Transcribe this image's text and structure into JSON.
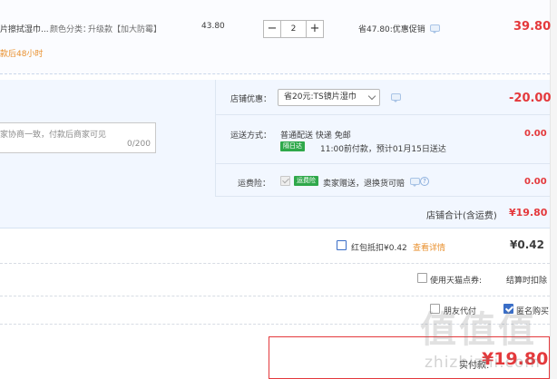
{
  "item": {
    "title_fragment": "片擦拭湿巾...",
    "spec_label": "颜色分类：",
    "spec_value": "升级款【加大防霉】",
    "unit_price": "43.80",
    "quantity": "2",
    "minus": "−",
    "plus": "+",
    "discount": "省47.80:优惠促销",
    "subtotal": "39.80",
    "ship_notice": "款后48小时"
  },
  "shop_promo": {
    "label": "店铺优惠：",
    "selected": "省20元:TS镜片湿巾",
    "amount": "-20.00"
  },
  "message": {
    "placeholder": "家协商一致，付款后商家可见",
    "counter": "0/200"
  },
  "shipping": {
    "label": "运送方式：",
    "method": "普通配送 快递 免邮",
    "badge": "隔日达",
    "eta": "11:00前付款，预计01月15日送达",
    "amount": "0.00"
  },
  "insurance": {
    "label": "运费险：",
    "badge": "运费险",
    "desc": "卖家赠送，退换货可赔",
    "amount": "0.00",
    "help": "?"
  },
  "shop_total": {
    "label": "店铺合计(含运费)",
    "amount": "¥19.80"
  },
  "red_packet": {
    "label": "红包抵扣¥0.42",
    "link": "查看详情",
    "amount": "¥0.42"
  },
  "tmall_points": {
    "label": "使用天猫点券:",
    "note": "结算时扣除"
  },
  "options": {
    "friend_pay": "朋友代付",
    "anonymous": "匿名购买"
  },
  "payment": {
    "label": "实付款:",
    "amount": "¥19.80"
  },
  "watermark": {
    "logo": "值值值",
    "site": "zhizhizhi.com"
  },
  "colors": {
    "accent_red": "#e4393c",
    "accent_orange": "#e9912f",
    "panel_blue": "#f2f7ff",
    "check_blue": "#3a6ec7"
  }
}
